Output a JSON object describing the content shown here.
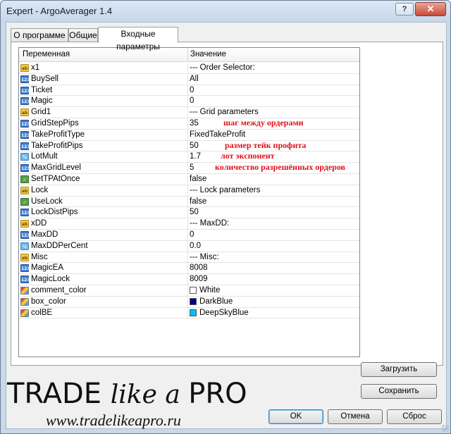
{
  "window": {
    "title": "Expert - ArgoAverager  1.4",
    "help_label": "?",
    "close_label": "✕"
  },
  "tabs": [
    {
      "label": "О программе",
      "active": false
    },
    {
      "label": "Общие",
      "active": false
    },
    {
      "label": "Входные параметры",
      "active": true
    }
  ],
  "grid": {
    "headers": {
      "variable": "Переменная",
      "value": "Значение"
    },
    "rows": [
      {
        "type": "ab",
        "icon": "string-type-icon",
        "name": "x1",
        "value": "--- Order Selector:"
      },
      {
        "type": "123",
        "icon": "integer-type-icon",
        "name": "BuySell",
        "value": "All"
      },
      {
        "type": "123",
        "icon": "integer-type-icon",
        "name": "Ticket",
        "value": "0"
      },
      {
        "type": "123",
        "icon": "integer-type-icon",
        "name": "Magic",
        "value": "0"
      },
      {
        "type": "ab",
        "icon": "string-type-icon",
        "name": "Grid1",
        "value": "--- Grid parameters"
      },
      {
        "type": "123",
        "icon": "integer-type-icon",
        "name": "GridStepPips",
        "value": "35",
        "note": "шаг между ордерами"
      },
      {
        "type": "123",
        "icon": "integer-type-icon",
        "name": "TakeProfitType",
        "value": "FixedTakeProfit"
      },
      {
        "type": "123",
        "icon": "integer-type-icon",
        "name": "TakeProfitPips",
        "value": "50",
        "note": "размер тейк профита"
      },
      {
        "type": "frac",
        "icon": "double-type-icon",
        "name": "LotMult",
        "value": "1.7",
        "note": "лот экспонент"
      },
      {
        "type": "123",
        "icon": "integer-type-icon",
        "name": "MaxGridLevel",
        "value": "5",
        "note": "количество разрешённых ордеров"
      },
      {
        "type": "bool",
        "icon": "boolean-type-icon",
        "name": "SetTPAtOnce",
        "value": "false"
      },
      {
        "type": "ab",
        "icon": "string-type-icon",
        "name": "Lock",
        "value": "--- Lock parameters"
      },
      {
        "type": "bool",
        "icon": "boolean-type-icon",
        "name": "UseLock",
        "value": "false"
      },
      {
        "type": "123",
        "icon": "integer-type-icon",
        "name": "LockDistPips",
        "value": "50"
      },
      {
        "type": "ab",
        "icon": "string-type-icon",
        "name": "xDD",
        "value": "--- MaxDD:"
      },
      {
        "type": "123",
        "icon": "integer-type-icon",
        "name": "MaxDD",
        "value": "0"
      },
      {
        "type": "frac",
        "icon": "double-type-icon",
        "name": "MaxDDPerCent",
        "value": "0.0"
      },
      {
        "type": "ab",
        "icon": "string-type-icon",
        "name": "Misc",
        "value": "--- Misc:"
      },
      {
        "type": "123",
        "icon": "integer-type-icon",
        "name": "MagicEA",
        "value": "8008"
      },
      {
        "type": "123",
        "icon": "integer-type-icon",
        "name": "MagicLock",
        "value": "8009"
      },
      {
        "type": "color",
        "icon": "color-type-icon",
        "name": "comment_color",
        "value": "White",
        "swatch": "#ffffff"
      },
      {
        "type": "color",
        "icon": "color-type-icon",
        "name": "box_color",
        "value": "DarkBlue",
        "swatch": "#00008b"
      },
      {
        "type": "color",
        "icon": "color-type-icon",
        "name": "colBE",
        "value": "DeepSkyBlue",
        "swatch": "#00bfff"
      }
    ]
  },
  "buttons": {
    "load": "Загрузить",
    "save": "Сохранить",
    "ok": "OK",
    "cancel": "Отмена",
    "reset": "Сброс"
  },
  "watermark": {
    "title_main": "TRADE ",
    "title_italic": "like a ",
    "title_end": "PRO",
    "url": "www.tradelikeapro.ru"
  },
  "colors": {
    "note_red": "#e0101a",
    "accent": "#3c7fb1"
  }
}
